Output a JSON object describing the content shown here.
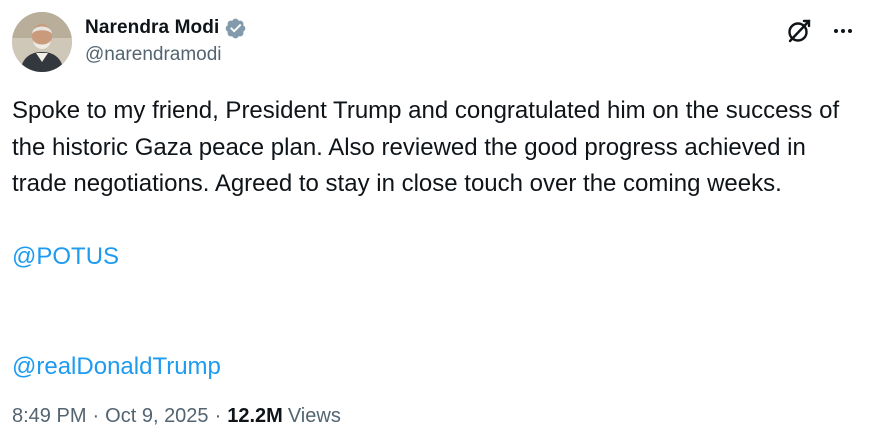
{
  "author": {
    "display_name": "Narendra Modi",
    "handle": "@narendramodi",
    "verified": true
  },
  "post": {
    "text": "Spoke to my friend, President Trump and congratulated him on the success of the historic Gaza peace plan. Also reviewed the good progress achieved in trade negotiations. Agreed to stay in close touch over the coming weeks.",
    "mention_1": "@POTUS",
    "mention_2": "@realDonaldTrump"
  },
  "meta": {
    "time": "8:49 PM",
    "separator": "·",
    "date": "Oct 9, 2025",
    "views_count": "12.2M",
    "views_label": "Views"
  },
  "icons": {
    "verified": "verified-badge-icon",
    "grok": "grok-icon",
    "more": "more-icon"
  },
  "colors": {
    "link": "#1d9bf0",
    "secondary_text": "#536471",
    "primary_text": "#0f1419",
    "badge": "#829aab"
  }
}
